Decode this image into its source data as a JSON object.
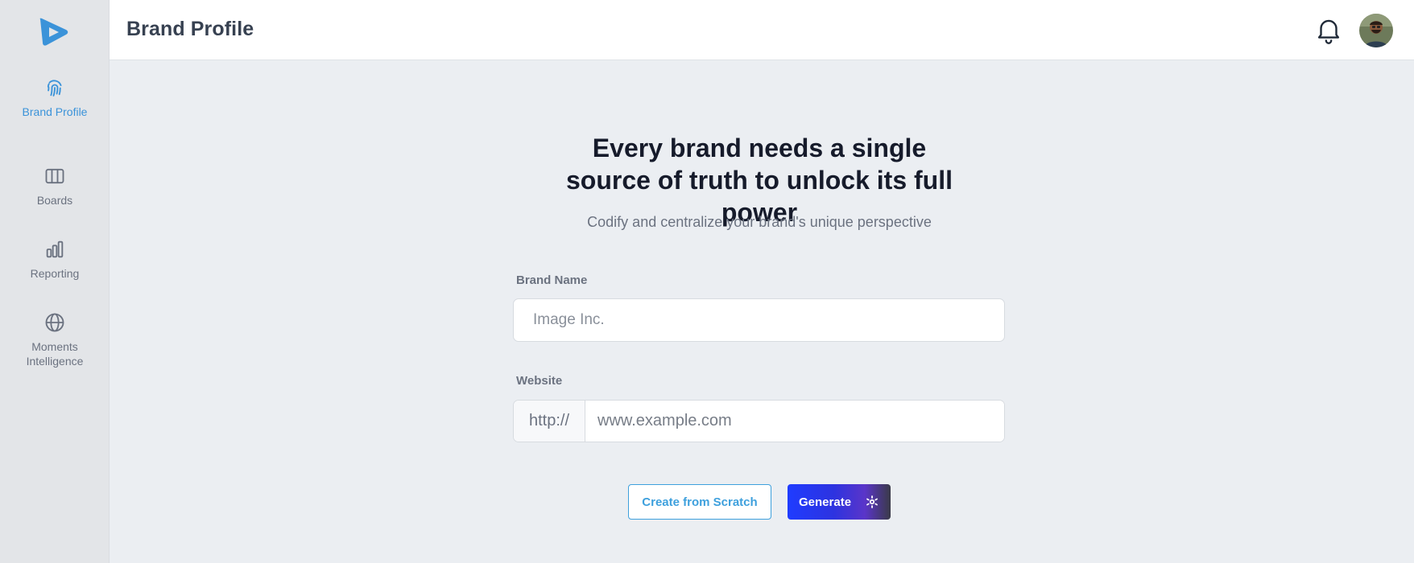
{
  "app": {
    "logo_icon": "play-logo-icon",
    "accent_color": "#3b93d9"
  },
  "sidebar": {
    "items": [
      {
        "label": "Brand Profile",
        "icon": "fingerprint-icon",
        "active": true
      },
      {
        "label": "Boards",
        "icon": "columns-icon",
        "active": false
      },
      {
        "label": "Reporting",
        "icon": "bar-chart-icon",
        "active": false
      },
      {
        "label": "Moments Intelligence",
        "icon": "globe-icon",
        "active": false
      }
    ]
  },
  "header": {
    "title": "Brand Profile",
    "bell_icon": "bell-icon",
    "avatar": "user-avatar"
  },
  "main": {
    "headline": "Every brand needs a single source of truth to unlock its full power",
    "subheadline": "Codify and centralize your brand's unique perspective",
    "brand_name": {
      "label": "Brand Name",
      "placeholder": "Image Inc.",
      "value": ""
    },
    "website": {
      "label": "Website",
      "prefix": "http://",
      "placeholder": "www.example.com",
      "value": ""
    },
    "buttons": {
      "create_label": "Create from Scratch",
      "generate_label": "Generate",
      "generate_icon": "sparkle-loader-icon"
    }
  }
}
